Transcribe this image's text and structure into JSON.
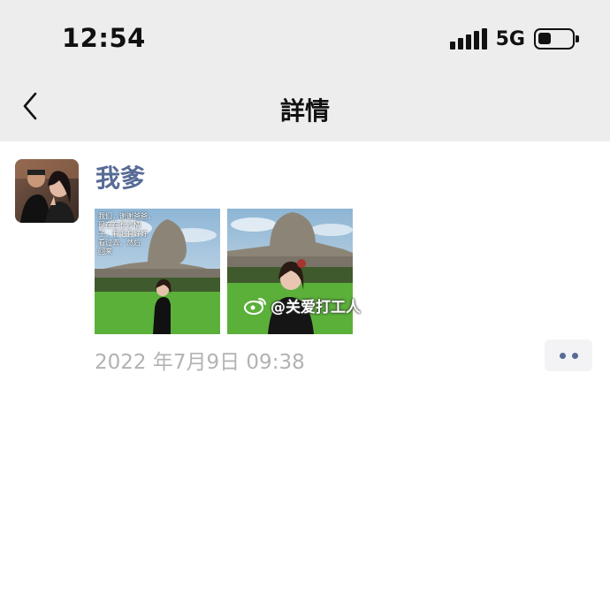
{
  "status_bar": {
    "time": "12:54",
    "network": "5G",
    "signal_icon": "cellular-signal-icon",
    "battery_icon": "battery-icon"
  },
  "nav": {
    "title": "詳情",
    "back_icon": "chevron-left-icon"
  },
  "post": {
    "author": "我爹",
    "timestamp": "2022 年7月9日  09:38",
    "photos": [
      {
        "caption_lines": [
          "我们，谢谢爸爸，",
          "现在在长沙橘",
          "子，有毛有好好",
          "看过去，然后",
          "回来"
        ]
      },
      {
        "caption_lines": []
      }
    ],
    "watermark": "@关爱打工人"
  },
  "colors": {
    "top_bar_bg": "#ededed",
    "author_name": "#576b95",
    "timestamp": "#b2b2b2",
    "more_dots": "#576b95"
  }
}
